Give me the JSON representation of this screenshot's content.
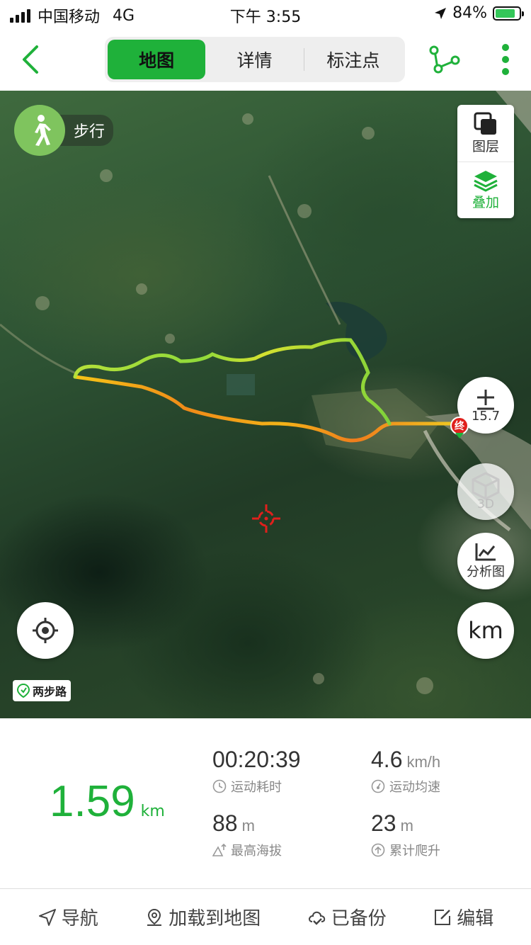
{
  "status_bar": {
    "carrier": "中国移动",
    "network": "4G",
    "time": "下午 3:55",
    "battery": "84%",
    "battery_level": 0.84
  },
  "nav": {
    "tabs": [
      {
        "label": "地图",
        "active": true
      },
      {
        "label": "详情",
        "active": false
      },
      {
        "label": "标注点",
        "active": false
      }
    ],
    "accent_color": "#1fb13a"
  },
  "map": {
    "mode_label": "步行",
    "layers_label": "图层",
    "overlay_label": "叠加",
    "zoom_level": "15.7",
    "three_d_label": "3D",
    "analysis_label": "分析图",
    "unit_label": "km",
    "end_marker": "终",
    "brand": "两步路"
  },
  "stats": {
    "distance": "1.59",
    "distance_unit": "km",
    "duration": "00:20:39",
    "duration_label": "运动耗时",
    "avg_speed": "4.6",
    "avg_speed_unit": "km/h",
    "avg_speed_label": "运动均速",
    "max_altitude": "88",
    "max_altitude_unit": "m",
    "max_altitude_label": "最高海拔",
    "total_climb": "23",
    "total_climb_unit": "m",
    "total_climb_label": "累计爬升"
  },
  "actions": {
    "navigate": "导航",
    "load_to_map": "加载到地图",
    "backed_up": "已备份",
    "edit": "编辑"
  }
}
